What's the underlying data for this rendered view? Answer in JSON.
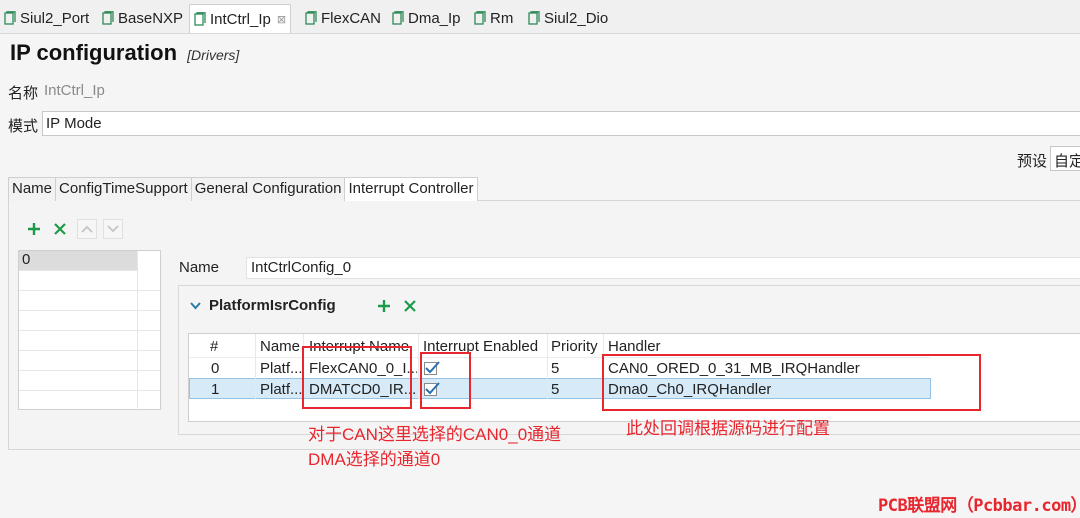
{
  "tabs": [
    {
      "label": "Siul2_Port",
      "active": false
    },
    {
      "label": "BaseNXP",
      "active": false
    },
    {
      "label": "IntCtrl_Ip",
      "active": true
    },
    {
      "label": "FlexCAN",
      "active": false
    },
    {
      "label": "Dma_Ip",
      "active": false
    },
    {
      "label": "Rm",
      "active": false
    },
    {
      "label": "Siul2_Dio",
      "active": false
    }
  ],
  "tab_close_glyph": "⊠",
  "page": {
    "title": "IP configuration",
    "subtitle": "[Drivers]"
  },
  "fields": {
    "name_label": "名称",
    "name_value": "IntCtrl_Ip",
    "mode_label": "模式",
    "mode_value": "IP Mode",
    "preset_label": "预设",
    "preset_value": "自定"
  },
  "subtabs": [
    {
      "label": "Name",
      "active": false
    },
    {
      "label": "ConfigTimeSupport",
      "active": false
    },
    {
      "label": "General Configuration",
      "active": false
    },
    {
      "label": "Interrupt Controller",
      "active": true
    }
  ],
  "toolbar_icons": [
    "add-icon",
    "remove-icon",
    "move-up-icon",
    "move-down-icon"
  ],
  "config_list": [
    "0"
  ],
  "detail": {
    "name_label": "Name",
    "name_value": "IntCtrlConfig_0"
  },
  "section": {
    "title": "PlatformIsrConfig"
  },
  "table": {
    "columns": [
      "#",
      "Name",
      "Interrupt Name",
      "Interrupt Enabled",
      "Priority",
      "Handler"
    ],
    "rows": [
      {
        "index": "0",
        "name": "Platf...",
        "interrupt_name": "FlexCAN0_0_I...",
        "enabled": true,
        "priority": "5",
        "handler": "CAN0_ORED_0_31_MB_IRQHandler"
      },
      {
        "index": "1",
        "name": "Platf...",
        "interrupt_name": "DMATCD0_IR...",
        "enabled": true,
        "priority": "5",
        "handler": "Dma0_Ch0_IRQHandler"
      }
    ],
    "selected_row": 1
  },
  "annotations": {
    "note_left_line1": "对于CAN这里选择的CAN0_0通道",
    "note_left_line2": "DMA选择的通道0",
    "note_right": "此处回调根据源码进行配置"
  },
  "watermark": "PCB联盟网（Pcbbar.com）",
  "colors": {
    "annotation_red": "#e8262e",
    "add_green": "#1d9a4a",
    "selection_blue": "#d6eaf8"
  }
}
